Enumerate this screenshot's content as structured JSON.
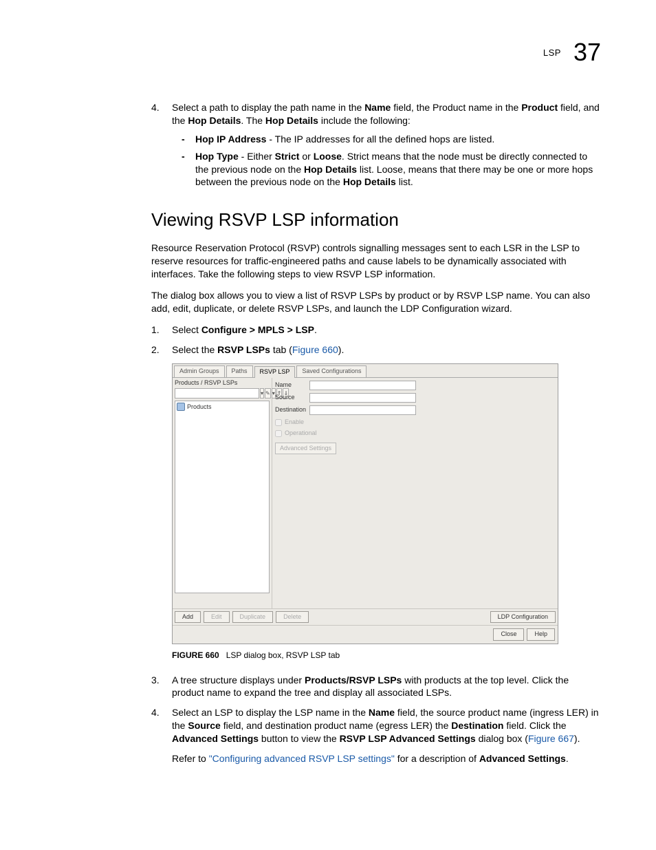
{
  "header": {
    "label": "LSP",
    "number": "37"
  },
  "top_list": {
    "item4": {
      "num": "4.",
      "text_prefix": "Select a path to display the path name in the ",
      "bold1": "Name",
      "text_mid1": " field, the Product name in the ",
      "bold2": "Product",
      "text_mid2": " field, and the ",
      "bold3": "Hop Details",
      "text_mid3": ". The ",
      "bold4": "Hop Details",
      "text_end": " include the following:",
      "sub": [
        {
          "bold": "Hop IP Address",
          "text": " - The IP addresses for all the defined hops are listed."
        },
        {
          "bold": "Hop Type",
          "text_prefix": " - Either ",
          "bold2": "Strict",
          "text_mid1": " or ",
          "bold3": "Loose",
          "text_mid2": ". Strict means that the node must be directly connected to the previous node on the ",
          "bold4": "Hop Details",
          "text_mid3": " list. Loose, means that there may be one or more hops between the previous node on the ",
          "bold5": "Hop Details",
          "text_end": " list."
        }
      ]
    }
  },
  "section_title": "Viewing RSVP LSP information",
  "para1": "Resource Reservation Protocol (RSVP) controls signalling messages sent to each LSR in the LSP to reserve resources for traffic-engineered paths and cause labels to be dynamically associated with interfaces. Take the following steps to view RSVP LSP information.",
  "para2": "The dialog box allows you to view a list of RSVP LSPs by product or by RSVP LSP name. You can also add, edit, duplicate, or delete RSVP LSPs, and launch the LDP Configuration wizard.",
  "steps1": [
    {
      "num": "1.",
      "prefix": "Select ",
      "bold": "Configure > MPLS > LSP",
      "suffix": "."
    },
    {
      "num": "2.",
      "prefix": "Select the ",
      "bold": "RSVP LSPs",
      "suffix": " tab (",
      "link": "Figure 660",
      "suffix2": ")."
    }
  ],
  "dialog": {
    "tabs": [
      "Admin Groups",
      "Paths",
      "RSVP LSP",
      "Saved Configurations"
    ],
    "active_tab_index": 2,
    "tree_header": "Products / RSVP LSPs",
    "tree_root": "Products",
    "form": {
      "name_label": "Name",
      "source_label": "Source",
      "dest_label": "Destination",
      "enable_label": "Enable",
      "operational_label": "Operational",
      "advanced_btn": "Advanced Settings"
    },
    "bottom_buttons_left": [
      "Add",
      "Edit",
      "Duplicate",
      "Delete"
    ],
    "bottom_buttons_right": "LDP Configuration",
    "footer_close": "Close",
    "footer_help": "Help"
  },
  "figure_caption": {
    "label": "FIGURE 660",
    "text": "LSP dialog box, RSVP LSP tab"
  },
  "steps2": {
    "item3": {
      "num": "3.",
      "prefix": "A tree structure displays under ",
      "bold": "Products/RSVP LSPs",
      "suffix": " with products at the top level. Click the product name to expand the tree and display all associated LSPs."
    },
    "item4": {
      "num": "4.",
      "text1": "Select an LSP to display the LSP name in the ",
      "b1": "Name",
      "text2": " field, the source product name (ingress LER) in the ",
      "b2": "Source",
      "text3": " field, and destination product name (egress LER) the ",
      "b3": "Destination",
      "text4": " field. Click the ",
      "b4": "Advanced Settings",
      "text5": " button to view the ",
      "b5": "RSVP LSP Advanced Settings",
      "text6": " dialog box (",
      "link": "Figure 667",
      "text7": ").",
      "refer_prefix": "Refer to ",
      "refer_link": "\"Configuring advanced RSVP LSP settings\"",
      "refer_mid": " for a description of ",
      "refer_bold": "Advanced Settings",
      "refer_suffix": "."
    }
  }
}
